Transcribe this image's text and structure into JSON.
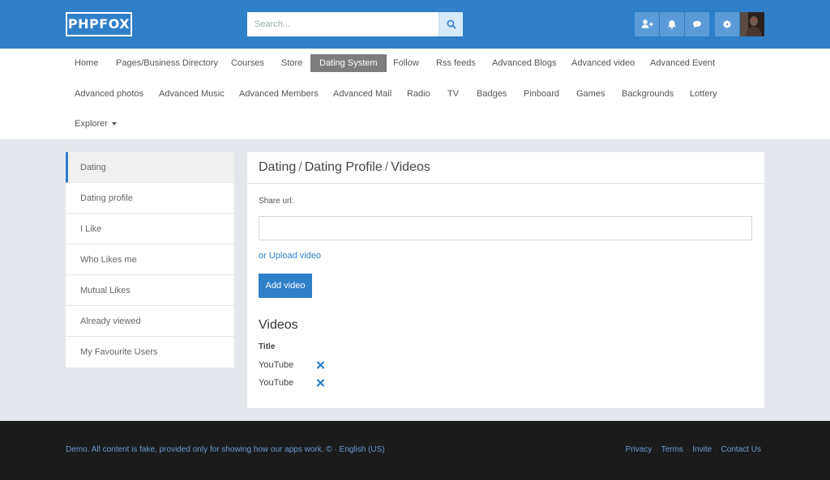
{
  "header": {
    "logo": "PHPFOX",
    "search_placeholder": "Search...",
    "icons": [
      "add-friend-icon",
      "bell-icon",
      "chat-icon",
      "gear-icon"
    ],
    "brand_color": "#2f7fc9"
  },
  "nav": {
    "items": [
      "Home",
      "Pages/Business Directory",
      "Courses",
      "Store",
      "Dating System",
      "Follow",
      "Rss feeds",
      "Advanced Blogs",
      "Advanced video",
      "Advanced Event",
      "Advanced photos",
      "Advanced Music",
      "Advanced Members",
      "Advanced Mail",
      "Radio",
      "TV",
      "Badges",
      "Pinboard",
      "Games",
      "Backgrounds",
      "Lottery",
      "Explorer"
    ],
    "active": "Dating System"
  },
  "sidebar": {
    "items": [
      "Dating",
      "Dating profile",
      "I Like",
      "Who Likes me",
      "Mutual Likes",
      "Already viewed",
      "My Favourite Users"
    ],
    "active": "Dating"
  },
  "main": {
    "breadcrumb": [
      "Dating",
      "Dating Profile",
      "Videos"
    ],
    "share_label": "Share url:",
    "share_value": "",
    "upload_link": "or Upload video",
    "add_button": "Add video",
    "videos_heading": "Videos",
    "table_header": "Title",
    "videos": [
      {
        "title": "YouTube"
      },
      {
        "title": "YouTube"
      }
    ]
  },
  "footer": {
    "text": "Demo. All content is fake, provided only for showing how our apps work. © · English (US)",
    "links": [
      "Privacy",
      "Terms",
      "Invite",
      "Contact Us"
    ]
  }
}
